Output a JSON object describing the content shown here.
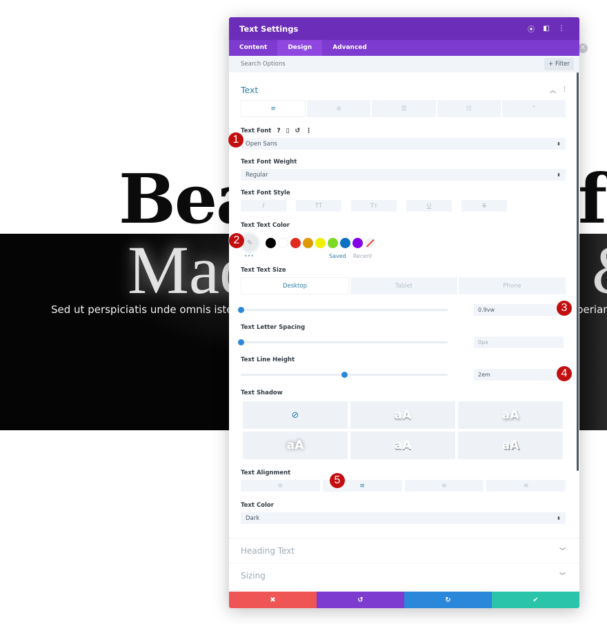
{
  "background": {
    "title_line1": "Bea",
    "title_line1_right": "f",
    "title_line2": "Mad",
    "title_line2_right": "&",
    "paragraph": "Sed ut perspiciatis unde omnis iste nat",
    "paragraph_right": "periam"
  },
  "modal": {
    "title": "Text Settings",
    "header_icons": [
      "focus-icon",
      "split-view-icon",
      "more-icon"
    ],
    "tabs": [
      {
        "label": "Content",
        "active": false
      },
      {
        "label": "Design",
        "active": true
      },
      {
        "label": "Advanced",
        "active": false
      }
    ],
    "search": {
      "placeholder": "Search Options",
      "filter_label": "+ Filter"
    },
    "section_title": "Text",
    "subtabs": [
      "paragraph-icon",
      "link-icon",
      "unordered-list-icon",
      "ordered-list-icon",
      "quote-icon"
    ],
    "fields": {
      "text_font": {
        "label": "Text Font",
        "value": "Open Sans"
      },
      "font_weight": {
        "label": "Text Font Weight",
        "value": "Regular"
      },
      "font_style": {
        "label": "Text Font Style",
        "options": [
          "I",
          "TT",
          "Tт",
          "U",
          "S"
        ]
      },
      "text_color": {
        "label": "Text Text Color",
        "swatches": [
          "#000000",
          "#ffffff",
          "#e02b20",
          "#e09900",
          "#edf000",
          "#7cda24",
          "#0c71c3",
          "#8300e9"
        ],
        "saved_label": "Saved",
        "recent_label": "Recent",
        "dots": "•••"
      },
      "text_size": {
        "label": "Text Text Size",
        "devices": [
          "Desktop",
          "Tablet",
          "Phone"
        ],
        "value": "0.9vw",
        "slider_fraction": 0.0
      },
      "letter_spacing": {
        "label": "Text Letter Spacing",
        "value": "0px",
        "slider_fraction": 0.0
      },
      "line_height": {
        "label": "Text Line Height",
        "value": "2em",
        "slider_fraction": 0.5
      },
      "text_shadow": {
        "label": "Text Shadow",
        "sample": "aA"
      },
      "text_alignment": {
        "label": "Text Alignment",
        "selected": "center"
      },
      "text_color_select": {
        "label": "Text Color",
        "value": "Dark"
      }
    },
    "collapsed_sections": [
      "Heading Text",
      "Sizing"
    ],
    "footer": {
      "cancel": "✖",
      "undo": "↺",
      "redo": "↻",
      "save": "✔",
      "colors": {
        "cancel": "#ef5555",
        "undo": "#7e3bd0",
        "redo": "#2b87da",
        "save": "#29c4a9"
      }
    }
  },
  "badges": [
    "1",
    "2",
    "3",
    "4",
    "5"
  ]
}
